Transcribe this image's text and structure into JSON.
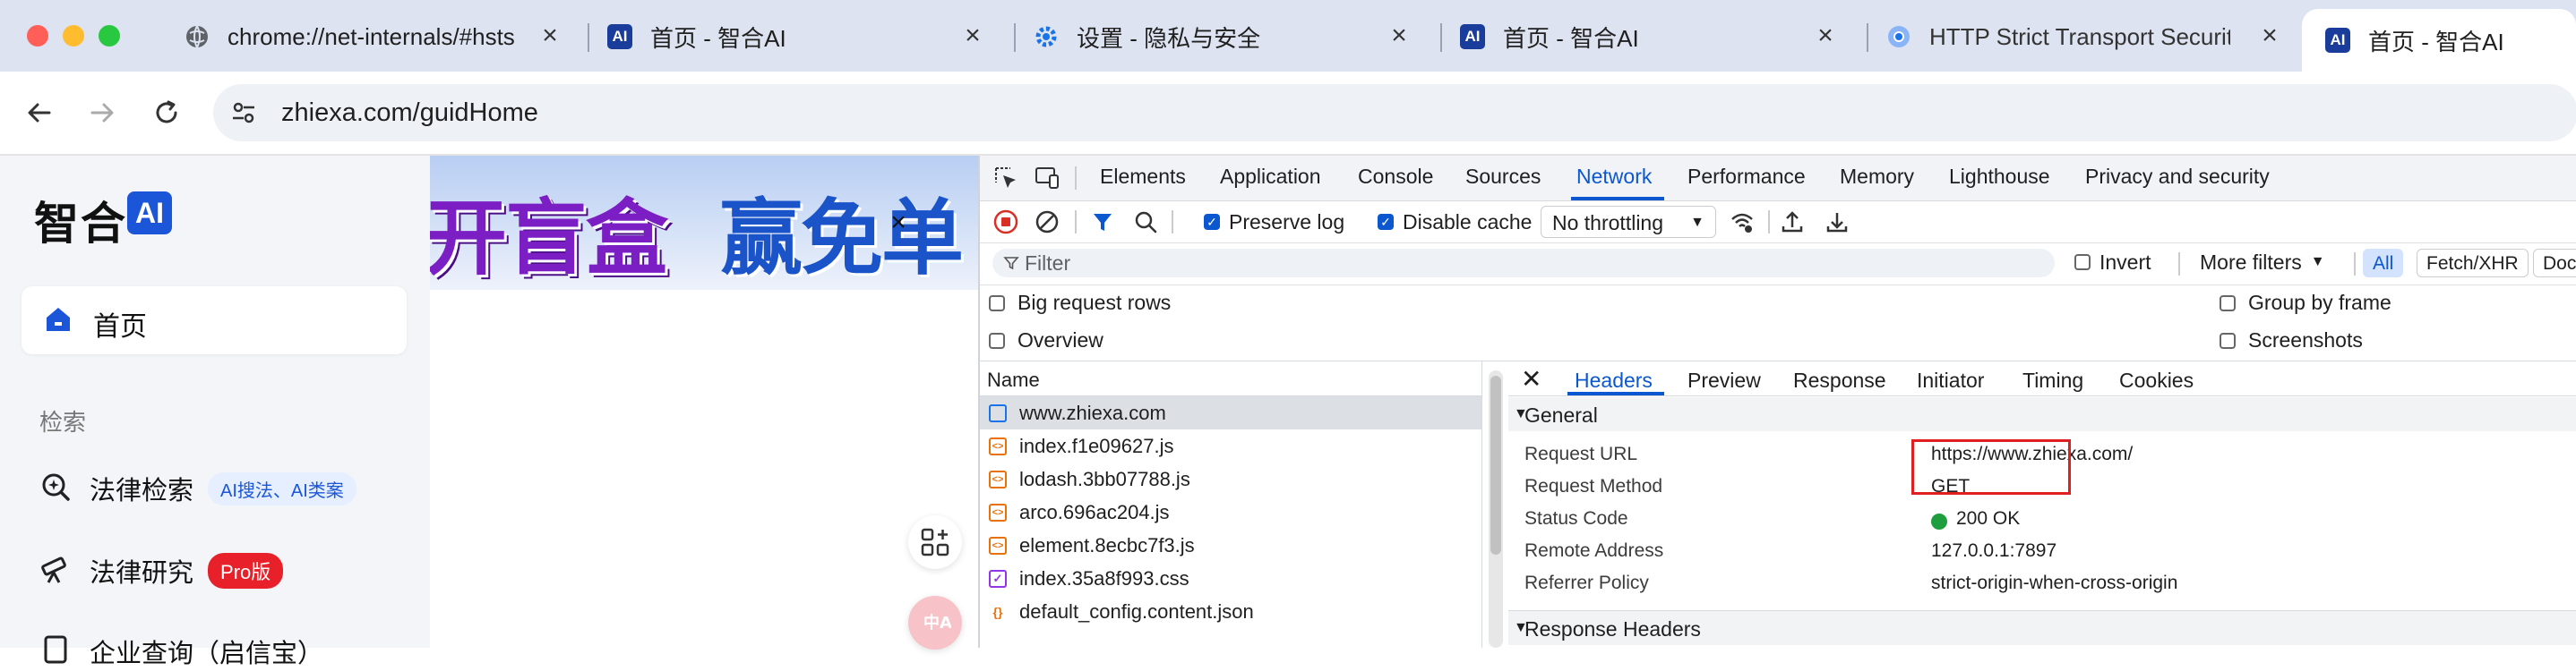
{
  "browser": {
    "tabs": [
      {
        "title": "chrome://net-internals/#hsts",
        "icon": "chrome-globe-icon"
      },
      {
        "title": "首页 - 智合AI",
        "icon": "zhihe-ai-icon"
      },
      {
        "title": "设置 - 隐私与安全",
        "icon": "settings-gear-icon"
      },
      {
        "title": "首页 - 智合AI",
        "icon": "zhihe-ai-icon"
      },
      {
        "title": "HTTP Strict Transport Securit",
        "icon": "chrome-logo-icon"
      },
      {
        "title": "首页 - 智合AI",
        "icon": "zhihe-ai-icon",
        "active": true
      }
    ],
    "url": "zhiexa.com/guidHome"
  },
  "site": {
    "logo_text": "智合",
    "logo_badge": "AI",
    "nav_home": "首页",
    "section_label": "检索",
    "nav_items": [
      {
        "label": "法律检索",
        "badge": "AI搜法、AI类案",
        "badge_style": "blue"
      },
      {
        "label": "法律研究",
        "badge": "Pro版",
        "badge_style": "red"
      },
      {
        "label": "企业查询（启信宝）"
      }
    ],
    "banner": {
      "part1": "开盲盒",
      "part2": "赢免单"
    },
    "colors": {
      "brand": "#1c56d8",
      "pro_badge": "#e8202a"
    }
  },
  "devtools": {
    "tabs": [
      "Elements",
      "Application",
      "Console",
      "Sources",
      "Network",
      "Performance",
      "Memory",
      "Lighthouse",
      "Privacy and security"
    ],
    "active_tab": "Network",
    "controls": {
      "preserve_log": "Preserve log",
      "preserve_log_checked": true,
      "disable_cache": "Disable cache",
      "disable_cache_checked": true,
      "throttling": "No throttling"
    },
    "filter": {
      "placeholder": "Filter",
      "invert": "Invert",
      "more_filters": "More filters",
      "type_chips": [
        "All",
        "Fetch/XHR",
        "Doc"
      ]
    },
    "options": {
      "big_request_rows": "Big request rows",
      "overview": "Overview",
      "group_by_frame": "Group by frame",
      "screenshots": "Screenshots"
    },
    "requests": {
      "column": "Name",
      "items": [
        {
          "name": "www.zhiexa.com",
          "type": "document"
        },
        {
          "name": "index.f1e09627.js",
          "type": "script"
        },
        {
          "name": "lodash.3bb07788.js",
          "type": "script"
        },
        {
          "name": "arco.696ac204.js",
          "type": "script"
        },
        {
          "name": "element.8ecbc7f3.js",
          "type": "script"
        },
        {
          "name": "index.35a8f993.css",
          "type": "stylesheet"
        },
        {
          "name": "default_config.content.json",
          "type": "json"
        }
      ]
    },
    "detail": {
      "tabs": [
        "Headers",
        "Preview",
        "Response",
        "Initiator",
        "Timing",
        "Cookies"
      ],
      "active_tab": "Headers",
      "general_label": "General",
      "general": [
        {
          "key": "Request URL",
          "value": "https://www.zhiexa.com/"
        },
        {
          "key": "Request Method",
          "value": "GET"
        },
        {
          "key": "Status Code",
          "value": "200 OK"
        },
        {
          "key": "Remote Address",
          "value": "127.0.0.1:7897"
        },
        {
          "key": "Referrer Policy",
          "value": "strict-origin-when-cross-origin"
        }
      ],
      "response_headers_label": "Response Headers",
      "colors": {
        "status_ok": "#1e9e3e",
        "highlight_box": "#e02020",
        "accent": "#0b57d0"
      }
    }
  }
}
